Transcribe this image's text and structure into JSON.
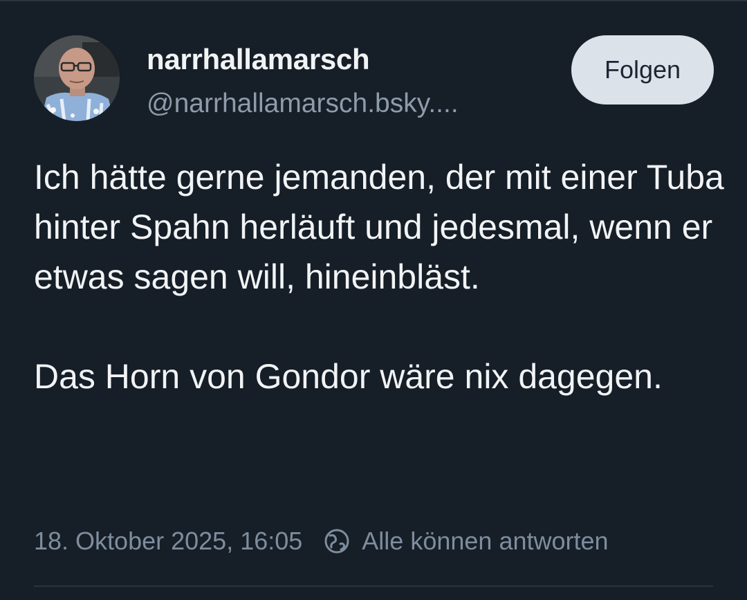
{
  "author": {
    "display_name": "narrhallamarsch",
    "handle": "@narrhallamarsch.bsky...."
  },
  "follow_button": {
    "label": "Folgen"
  },
  "post": {
    "paragraphs": [
      "Ich hätte gerne jemanden, der mit einer Tuba hinter Spahn herläuft und jedesmal, wenn er etwas sagen will, hineinbläst.",
      "Das Horn von Gondor wäre nix dagegen."
    ]
  },
  "meta": {
    "timestamp": "18. Oktober 2025, 16:05",
    "reply_setting": "Alle können antworten",
    "reply_icon": "globe-icon"
  },
  "colors": {
    "background": "#161e27",
    "text_primary": "#f1f3f5",
    "text_secondary": "#8e9bab",
    "button_bg": "#dce2ea",
    "button_text": "#1b2633"
  }
}
